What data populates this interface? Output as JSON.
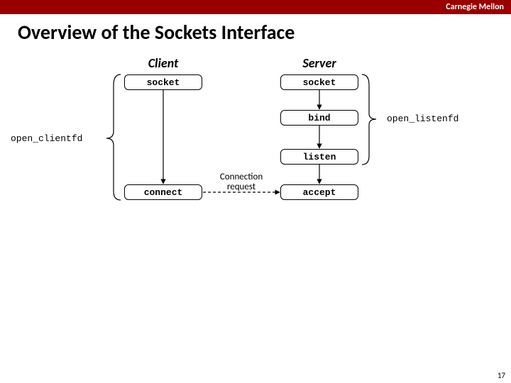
{
  "header": {
    "brand": "Carnegie Mellon"
  },
  "title": "Overview of the Sockets Interface",
  "columns": {
    "client": "Client",
    "server": "Server"
  },
  "boxes": {
    "client_socket": "socket",
    "client_connect": "connect",
    "server_socket": "socket",
    "server_bind": "bind",
    "server_listen": "listen",
    "server_accept": "accept"
  },
  "labels": {
    "open_clientfd": "open_clientfd",
    "open_listenfd": "open_listenfd",
    "connection_request": "Connection\nrequest"
  },
  "page_number": "17"
}
